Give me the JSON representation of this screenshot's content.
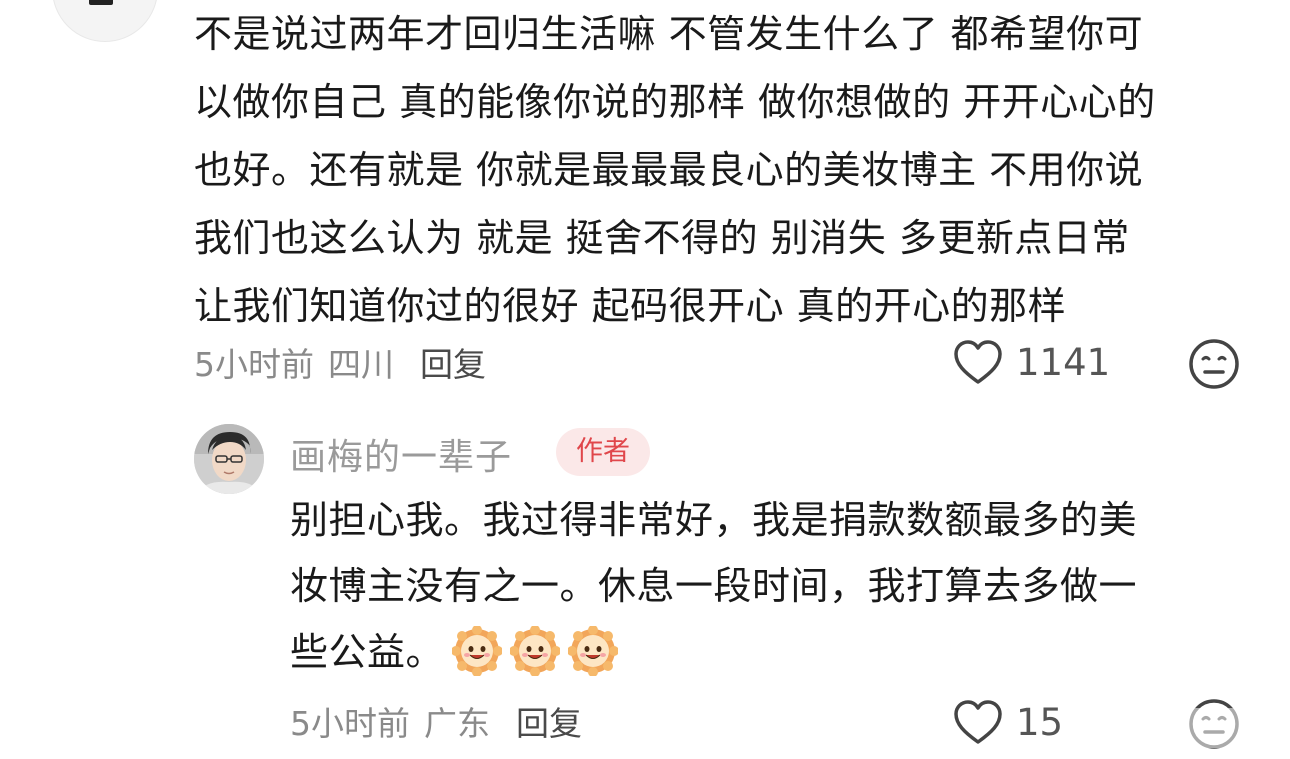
{
  "comment": {
    "lines": [
      "不是说过两年才回归生活嘛 不管发生什么了 都希望你可",
      "以做你自己 真的能像你说的那样  做你想做的 开开心心的",
      "也好。还有就是 你就是最最最良心的美妆博主 不用你说",
      "我们也这么认为 就是 挺舍不得的 别消失 多更新点日常",
      "让我们知道你过的很好 起码很开心 真的开心的那样"
    ],
    "time": "5小时前",
    "location": "四川",
    "reply_label": "回复",
    "like_count": "1141",
    "like_icon": "heart-outline-icon",
    "dislike_icon": "meh-face-icon"
  },
  "reply": {
    "username": "画梅的一辈子",
    "badge": "作者",
    "lines": [
      "别担心我。我过得非常好，我是捐款数额最多的美",
      "妆博主没有之一。休息一段时间，我打算去多做一",
      "些公益。"
    ],
    "emoji": [
      "sun-smile-emoji",
      "sun-smile-emoji",
      "sun-smile-emoji"
    ],
    "time": "5小时前",
    "location": "广东",
    "reply_label": "回复",
    "like_count": "15",
    "like_icon": "heart-outline-icon",
    "dislike_icon": "meh-face-icon"
  },
  "colors": {
    "badge_bg": "#fbe8e8",
    "badge_text": "#e0474b",
    "meta_text": "#8a8a8a",
    "body_text": "#1a1a1a"
  }
}
